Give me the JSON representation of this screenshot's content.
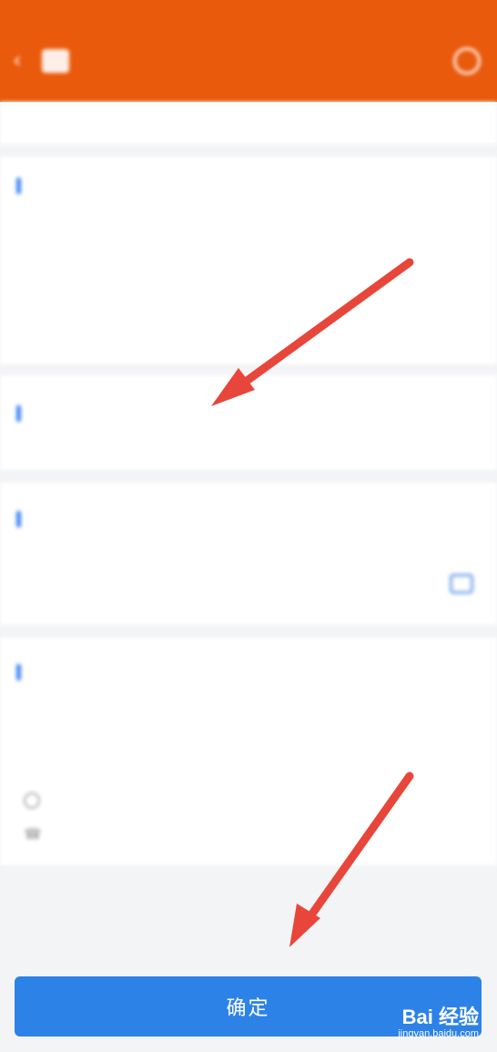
{
  "status_bar": {
    "left": "",
    "right": ""
  },
  "header": {
    "back_label": "",
    "title": "",
    "subtitle": ""
  },
  "notice": "",
  "personal": {
    "title": "",
    "name_label": "",
    "phone_label": ""
  },
  "business": {
    "title": "",
    "value": ""
  },
  "time": {
    "title": "",
    "date_label": ""
  },
  "agency": {
    "title": "",
    "link": "",
    "address": "",
    "phone": ""
  },
  "confirm_label": "确定",
  "watermark": {
    "brand": "Bai 经验",
    "url": "jingyan.baidu.com"
  },
  "colors": {
    "header": "#e95a0c",
    "accent": "#2d82e8",
    "arrow": "#e8463a"
  }
}
